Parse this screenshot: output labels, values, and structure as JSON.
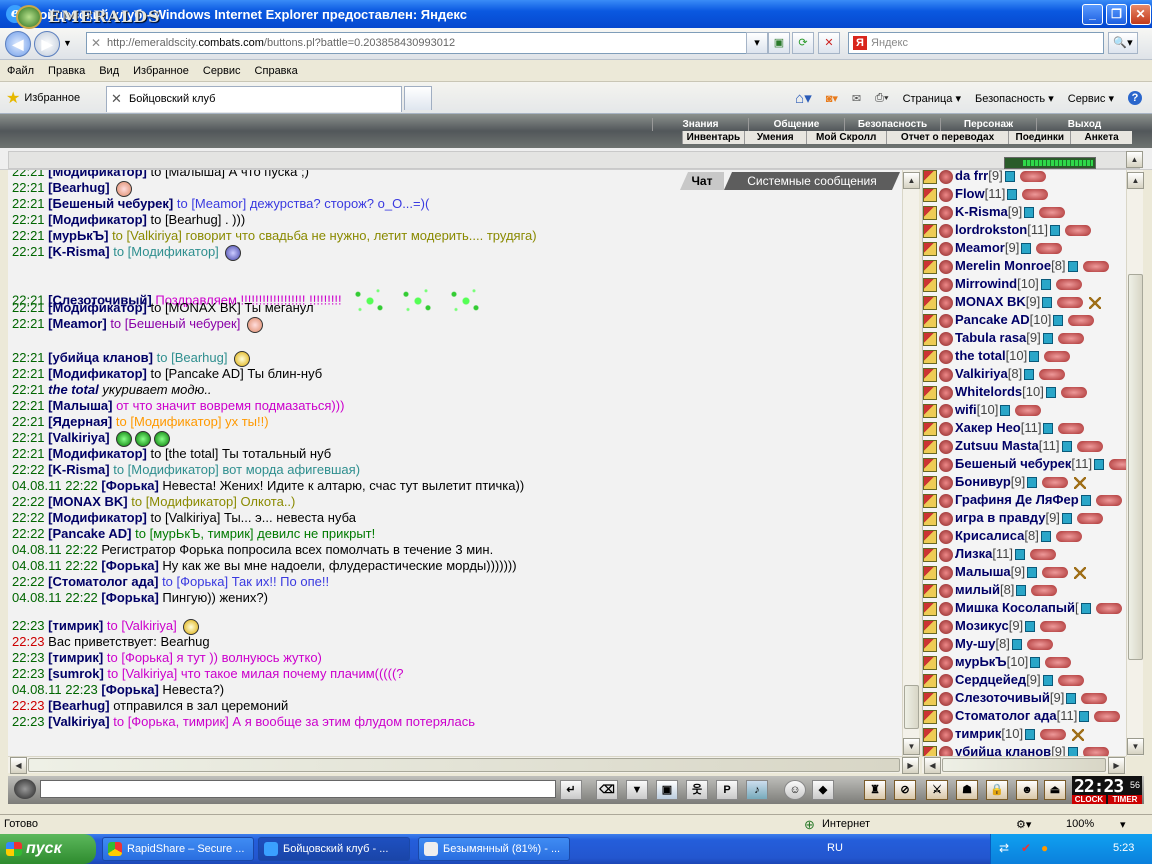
{
  "window": {
    "title": "Бойцовский клуб - Windows Internet Explorer предоставлен: Яндекс"
  },
  "address": {
    "url_prefix": "http://emeraldscity.",
    "url_domain": "combats.com",
    "url_suffix": "/buttons.pl?battle=0.203858430993012",
    "search_placeholder": "Яндекс"
  },
  "menu": [
    "Файл",
    "Правка",
    "Вид",
    "Избранное",
    "Сервис",
    "Справка"
  ],
  "tabs": {
    "favorites": "Избранное",
    "active_tab": "Бойцовский клуб",
    "commands": [
      "Страница ▾",
      "Безопасность ▾",
      "Сервис ▾"
    ]
  },
  "game": {
    "logo": "EMERALDS",
    "top_menu": [
      "Знания",
      "Общение",
      "Безопасность",
      "Персонаж",
      "Выход"
    ],
    "sub_menu": [
      "Инвентарь",
      "Умения",
      "Мой Скролл",
      "Отчет о переводах",
      "Поединки",
      "Анкета"
    ],
    "chat_tabs": [
      "Чат",
      "Системные сообщения"
    ]
  },
  "chat": [
    {
      "time": "22:21",
      "nick": "[Модификатор]",
      "to": "to [Малыша]",
      "text": "А что пуска ;)",
      "color": "c-dark"
    },
    {
      "time": "22:21",
      "nick": "[Bearhug]",
      "to": "",
      "text": "",
      "color": "c-dark"
    },
    {
      "time": "22:21",
      "nick": "[Бешеный чебурек]",
      "to": "to [Meamor]",
      "text": "дежурства? сторож? о_О...=)(",
      "color": "c-blue"
    },
    {
      "time": "22:21",
      "nick": "[Модификатор]",
      "to": "to [Bearhug]",
      "text": ". )))",
      "color": "c-dark"
    },
    {
      "time": "22:21",
      "nick": "[мурЬкЪ]",
      "to": "to [Valkiriya]",
      "text": "говорит что свадьба не нужно, летит модерить.... трудяга)",
      "color": "c-olive"
    },
    {
      "time": "22:21",
      "nick": "[K-Risma]",
      "to": "to [Модификатор]",
      "text": "",
      "color": "c-teal"
    },
    {
      "time": "22:21",
      "nick": "[Слезоточивый]",
      "to": "",
      "text": "Поздравляем.!!!!!!!!!!!!!!!!!! !!!!!!!!!",
      "color": "c-mag"
    },
    {
      "time": "22:21",
      "nick": "[Модификатор]",
      "to": "to [MONAX BK]",
      "text": "Ты меганул",
      "color": "c-dark"
    },
    {
      "time": "22:21",
      "nick": "[Meamor]",
      "to": "to [Бешеный чебурек]",
      "text": "",
      "color": "c-purple"
    },
    {
      "time": "22:21",
      "nick": "[убийца кланов]",
      "to": "to [Bearhug]",
      "text": "",
      "color": "c-teal"
    },
    {
      "time": "22:21",
      "nick": "[Модификатор]",
      "to": "to [Pancake AD]",
      "text": "Ты блин-нуб",
      "color": "c-dark"
    },
    {
      "time": "22:21",
      "nick": "the total",
      "to": "",
      "text": "укуривает модю..",
      "color": "c-dark",
      "italic": true
    },
    {
      "time": "22:21",
      "nick": "[Малыша]",
      "to": "",
      "text": "от что значит вовремя подмазаться)))",
      "color": "c-mag"
    },
    {
      "time": "22:21",
      "nick": "[Ядерная]",
      "to": "to [Модификатор]",
      "text": "ух ты!!)",
      "color": "c-orange"
    },
    {
      "time": "22:21",
      "nick": "[Valkiriya]",
      "to": "",
      "text": "",
      "color": "c-dark"
    },
    {
      "time": "22:21",
      "nick": "[Модификатор]",
      "to": "to [the total]",
      "text": "Ты тотальный нуб",
      "color": "c-dark"
    },
    {
      "time": "22:22",
      "nick": "[K-Risma]",
      "to": "to [Модификатор]",
      "text": "вот морда афигевшая)",
      "color": "c-teal"
    },
    {
      "time": "04.08.11 22:22",
      "nick": "[Форька]",
      "to": "",
      "text": "Невеста! Жених! Идите к алтарю, счас тут вылетит птичка))",
      "color": "c-dark"
    },
    {
      "time": "22:22",
      "nick": "[MONAX BK]",
      "to": "to [Модификатор]",
      "text": "Олкота..)",
      "color": "c-olive"
    },
    {
      "time": "22:22",
      "nick": "[Модификатор]",
      "to": "to [Valkiriya]",
      "text": "Ты... э... невеста нуба",
      "color": "c-dark"
    },
    {
      "time": "22:22",
      "nick": "[Pancake AD]",
      "to": "to [мурЬкЪ, тимрик]",
      "text": "девилс не прикрыт!",
      "color": "c-green"
    },
    {
      "time": "04.08.11 22:22",
      "nick": "",
      "to": "",
      "text": "Регистратор Форька попросила всех помолчать в течение 3 мин.",
      "color": "c-dark"
    },
    {
      "time": "04.08.11 22:22",
      "nick": "[Форька]",
      "to": "",
      "text": "Ну как же вы мне надоели, флудерастические морды)))))))",
      "color": "c-dark"
    },
    {
      "time": "22:22",
      "nick": "[Стоматолог ада]",
      "to": "to [Форька]",
      "text": "Так их!! По опе!!",
      "color": "c-blue"
    },
    {
      "time": "04.08.11 22:22",
      "nick": "[Форька]",
      "to": "",
      "text": "Пингую)) жених?)",
      "color": "c-dark"
    },
    {
      "time": "22:23",
      "nick": "[тимрик]",
      "to": "to [Valkiriya]",
      "text": "",
      "color": "c-mag"
    },
    {
      "time": "22:23",
      "nick": "",
      "to": "",
      "text": "Вас приветствует: Bearhug",
      "color": "c-dark",
      "red": true
    },
    {
      "time": "22:23",
      "nick": "[тимрик]",
      "to": "to [Форька]",
      "text": "я тут )) волнуюсь жутко)",
      "color": "c-mag"
    },
    {
      "time": "22:23",
      "nick": "[sumrok]",
      "to": "to [Valkiriya]",
      "text": "что такое милая почему плачим(((((?",
      "color": "c-mag"
    },
    {
      "time": "04.08.11 22:23",
      "nick": "[Форька]",
      "to": "",
      "text": "Невеста?)",
      "color": "c-dark"
    },
    {
      "time": "22:23",
      "nick": "[Bearhug]",
      "to": "",
      "text": "отправился в зал церемоний",
      "color": "c-dark",
      "red": true
    },
    {
      "time": "22:23",
      "nick": "[Valkiriya]",
      "to": "to [Форька, тимрик]",
      "text": "А я вообще за этим флудом потерялась",
      "color": "c-mag"
    }
  ],
  "users": [
    {
      "name": "da frr",
      "level": "[9]"
    },
    {
      "name": "Flow",
      "level": "[11]"
    },
    {
      "name": "K-Risma",
      "level": "[9]"
    },
    {
      "name": "lordrokston",
      "level": "[11]"
    },
    {
      "name": "Meamor",
      "level": "[9]"
    },
    {
      "name": "Merelin Monroe",
      "level": "[8]"
    },
    {
      "name": "Mirrowind",
      "level": "[10]"
    },
    {
      "name": "MONAX BK",
      "level": "[9]"
    },
    {
      "name": "Pancake AD",
      "level": "[10]"
    },
    {
      "name": "Tabula rasa",
      "level": "[9]"
    },
    {
      "name": "the total",
      "level": "[10]"
    },
    {
      "name": "Valkiriya",
      "level": "[8]"
    },
    {
      "name": "Whitelords",
      "level": "[10]"
    },
    {
      "name": "wifi",
      "level": "[10]"
    },
    {
      "name": "Хакер Нео",
      "level": "[11]"
    },
    {
      "name": "Zutsuu Masta",
      "level": "[11]"
    },
    {
      "name": "Бешеный чебурек",
      "level": "[11]"
    },
    {
      "name": "Бонивур",
      "level": "[9]"
    },
    {
      "name": "Графиня Де ЛяФер",
      "level": ""
    },
    {
      "name": "игра в правду",
      "level": "[9]"
    },
    {
      "name": "Крисалиса",
      "level": "[8]"
    },
    {
      "name": "Лизка",
      "level": "[11]"
    },
    {
      "name": "Малыша",
      "level": "[9]"
    },
    {
      "name": "милый",
      "level": "[8]"
    },
    {
      "name": "Мишка Косолапый",
      "level": "["
    },
    {
      "name": "Мозикус",
      "level": "[9]"
    },
    {
      "name": "Му-шу",
      "level": "[8]"
    },
    {
      "name": "мурЬкЪ",
      "level": "[10]"
    },
    {
      "name": "Сердцейед",
      "level": "[9]"
    },
    {
      "name": "Слезоточивый",
      "level": "[9]"
    },
    {
      "name": "Стоматолог ада",
      "level": "[11]"
    },
    {
      "name": "тимрик",
      "level": "[10]"
    },
    {
      "name": "убийца кланов",
      "level": "[9]"
    }
  ],
  "clock": {
    "time": "22:23",
    "sec": "56",
    "clock_label": "CLOCK",
    "timer_label": "TIMER"
  },
  "status": {
    "left": "Готово",
    "zone": "Интернет",
    "zoom": "100%"
  },
  "taskbar": {
    "start": "пуск",
    "tasks": [
      "RapidShare – Secure ...",
      "Бойцовский клуб - ...",
      "Безымянный (81%) - ..."
    ],
    "lang": "RU",
    "time": "5:23"
  }
}
